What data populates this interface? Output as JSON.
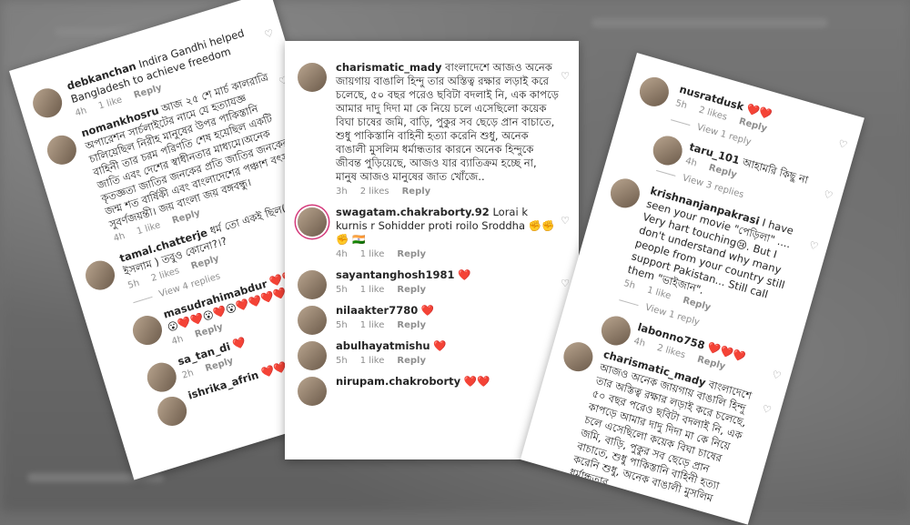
{
  "left": {
    "comments": [
      {
        "user": "debkanchan",
        "text": "Indira Gandhi helped Bangladesh to achieve freedom",
        "time": "4h",
        "likes": "1 like",
        "reply": "Reply"
      },
      {
        "user": "nomankhosru",
        "text": "আজ ২৫ শে মার্চ কালরাত্রি অপারেশন সার্চলাইটের নামে যে হত্যাযজ্ঞ চালিয়েছিল নিরীহ মানুষের উপর পাকিস্তানি বাহিনী তার চরম পরিণতি শেষ হয়েছিল একটি জাতি এবং দেশের স্বাধীনতার মাধ্যমে।অনেক কৃতজ্ঞতা জাতির জনকের প্রতি জাতির জনকের জন্ম শত বার্ষিকী এবং বাংলাদেশের পঞ্চাশ বৎসর সুবর্ণজয়ন্তী। জয় বাংলা জয় বঙ্গবন্ধু।",
        "time": "4h",
        "likes": "1 like",
        "reply": "Reply"
      },
      {
        "user": "tamal.chatterje",
        "text": "ধর্ম তো একই ছিল( ইসলাম ) তবুও কোনো?।?",
        "time": "5h",
        "likes": "2 likes",
        "reply": "Reply"
      }
    ],
    "view_replies": "View 4 replies",
    "replies": [
      {
        "user": "masudrahimabdur",
        "text": "❤️❤️😮❤️😮😮❤️❤️😮❤️😮❤️❤️❤️❤️",
        "time": "4h",
        "reply": "Reply"
      },
      {
        "user": "sa_tan_di",
        "text": "❤️",
        "time": "2h",
        "reply": "Reply"
      },
      {
        "user": "ishrika_afrin",
        "text": "❤️❤️",
        "time": "",
        "reply": ""
      }
    ]
  },
  "middle": {
    "comments": [
      {
        "user": "charismatic_mady",
        "text": "বাংলাদেশে আজও অনেক জায়গায় বাঙালি হিন্দু তার অস্তিত্ব রক্ষার লড়াই করে চলেছে, ৫০ বছর পরেও ছবিটা বদলাই নি, এক কাপড়ে আমার দাদু দিদা মা কে নিয়ে চলে এসেছিলো কয়েক বিঘা চাষের জমি, বাড়ি, পুকুর সব ছেড়ে প্রান বাচাতে, শুধু পাকিস্তানি বাহিনী হত্যা করেনি শুধু, অনেক বাঙালী মুসলিম ধর্মান্ধতার কারনে অনেক হিন্দুকে জীবন্ত পুড়িয়েছে, আজও যার ব্যাতিক্রম হচ্ছে না, মানুষ আজও মানুষের জাত খোঁজে..",
        "time": "3h",
        "likes": "2 likes",
        "reply": "Reply",
        "ring": false
      },
      {
        "user": "swagatam.chakraborty.92",
        "text": "Lorai k kurnis r Sohidder proti roilo Sroddha ✊✊✊ 🇮🇳",
        "time": "4h",
        "likes": "1 like",
        "reply": "Reply",
        "ring": true
      },
      {
        "user": "sayantanghosh1981",
        "text": "❤️",
        "time": "5h",
        "likes": "1 like",
        "reply": "Reply",
        "ring": false
      },
      {
        "user": "nilaakter7780",
        "text": "❤️",
        "time": "5h",
        "likes": "1 like",
        "reply": "Reply",
        "ring": false
      },
      {
        "user": "abulhayatmishu",
        "text": "❤️",
        "time": "5h",
        "likes": "1 like",
        "reply": "Reply",
        "ring": false
      },
      {
        "user": "nirupam.chakroborty",
        "text": "❤️❤️",
        "time": "",
        "likes": "",
        "reply": "",
        "ring": false
      }
    ]
  },
  "right": {
    "items": [
      {
        "kind": "comment",
        "user": "nusratdusk",
        "text": "❤️❤️",
        "time": "5h",
        "likes": "2 likes",
        "reply": "Reply"
      },
      {
        "kind": "view",
        "text": "View 1 reply"
      },
      {
        "kind": "reply",
        "user": "taru_101",
        "text": "আহামরি কিছু না",
        "time": "4h",
        "likes": "",
        "reply": "Reply"
      },
      {
        "kind": "view",
        "text": "View 3 replies"
      },
      {
        "kind": "comment",
        "user": "krishnanjanpakrasi",
        "text": "I have seen your movie \"পেড়িলা\" .... Very hart touching😢. But I don't understand why many people from your country still support Pakistan... Still call them \"ভাইজান\".",
        "time": "5h",
        "likes": "1 like",
        "reply": "Reply"
      },
      {
        "kind": "view",
        "text": "View 1 reply"
      },
      {
        "kind": "reply",
        "user": "labonno758",
        "text": "❤️❤️❤️",
        "time": "4h",
        "likes": "2 likes",
        "reply": "Reply"
      },
      {
        "kind": "comment",
        "user": "charismatic_mady",
        "text": "বাংলাদেশে আজও অনেক জায়গায় বাঙালি হিন্দু তার অস্তিত্ব রক্ষার লড়াই করে চলেছে, ৫০ বছর পরেও ছবিটা বদলাই নি, এক কাপড়ে আমার দাদু দিদা মা কে নিয়ে চলে এসেছিলো কয়েক বিঘা চাষের জমি, বাড়ি, পুকুর সব ছেড়ে প্রান বাচাতে, শুধু পাকিস্তানি বাহিনী হত্যা করেনি শুধু, অনেক বাঙালী মুসলিম ধর্মান্ধতার",
        "time": "",
        "likes": "",
        "reply": ""
      }
    ]
  },
  "icons": {
    "heart": "heart-outline-icon"
  },
  "colors": {
    "accent": "#ed4956",
    "muted": "#8e8e8e",
    "text": "#262626"
  }
}
